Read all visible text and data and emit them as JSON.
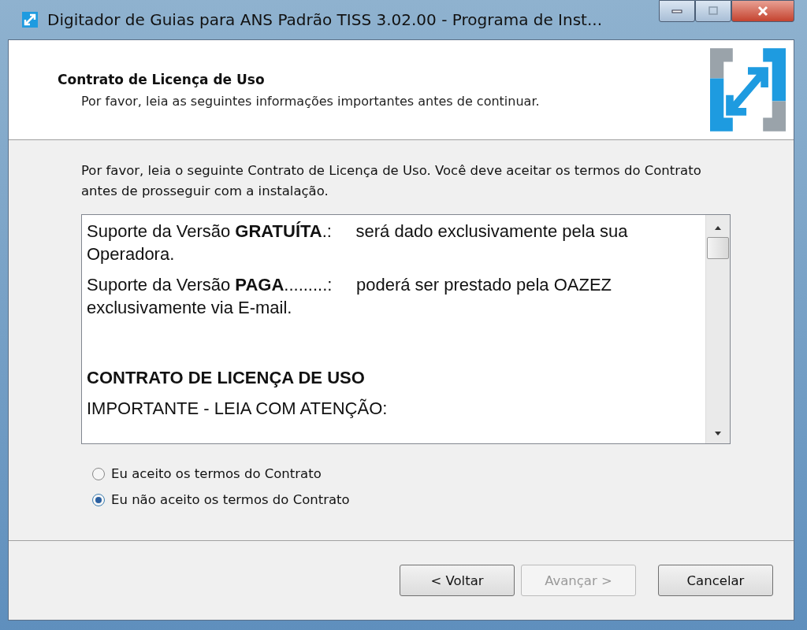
{
  "window": {
    "title": "Digitador de Guias para ANS Padrão TISS 3.02.00 - Programa de Inst..."
  },
  "header": {
    "title": "Contrato de Licença de Uso",
    "subtitle": "Por favor, leia as seguintes informações importantes antes de continuar."
  },
  "intro": "Por favor, leia o seguinte Contrato de Licença de Uso. Você deve aceitar os termos do Contrato antes de prosseguir com a instalação.",
  "license_text": [
    {
      "kind": "paragraph",
      "text": "Suporte da Versão **GRATUÍTA**.:     será dado exclusivamente pela sua Operadora."
    },
    {
      "kind": "paragraph",
      "text": "Suporte da Versão **PAGA**.........:     poderá ser prestado pela OAZEZ exclusivamente via E-mail."
    },
    {
      "kind": "heading",
      "text": "CONTRATO DE LICENÇA DE USO"
    },
    {
      "kind": "paragraph",
      "text": "IMPORTANTE - LEIA COM ATENÇÃO:"
    }
  ],
  "options": [
    {
      "label": "Eu aceito os termos do Contrato",
      "selected": false
    },
    {
      "label": "Eu não aceito os termos do Contrato",
      "selected": true
    }
  ],
  "buttons": [
    {
      "label": "< Voltar",
      "disabled": false
    },
    {
      "label": "Avançar >",
      "disabled": true
    },
    {
      "label": "Cancelar",
      "disabled": false
    }
  ]
}
